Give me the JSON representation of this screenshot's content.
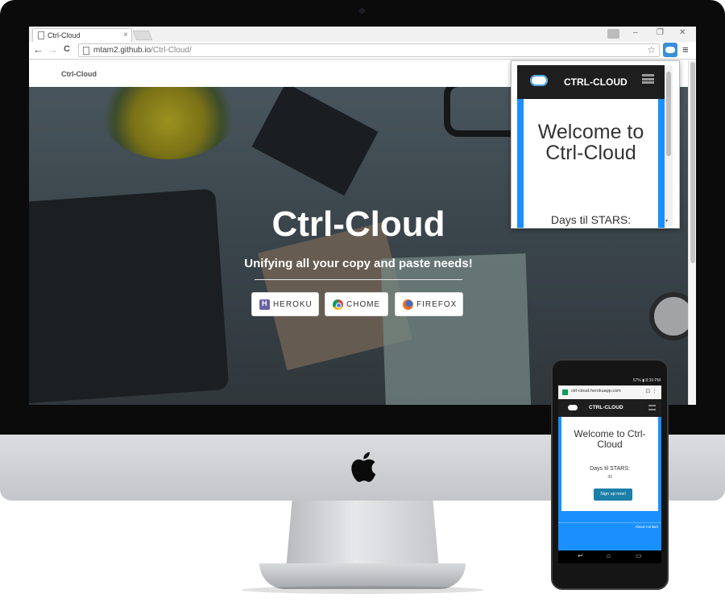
{
  "browser": {
    "tab_title": "Ctrl-Cloud",
    "tab_close": "×",
    "window_controls": {
      "minimize": "–",
      "restore": "❐",
      "close": "✕"
    },
    "nav": {
      "back": "←",
      "forward": "→",
      "reload": "C"
    },
    "url_host": "mtam2.github.io",
    "url_path": "/Ctrl-Cloud/",
    "star": "☆",
    "menu": "≡"
  },
  "site": {
    "brand": "Ctrl-Cloud",
    "hero_title": "Ctrl-Cloud",
    "hero_subtitle": "Unifying all your copy and paste needs!",
    "buttons": [
      {
        "label": "HEROKU",
        "icon": "heroku-icon"
      },
      {
        "label": "CHOME",
        "icon": "chrome-icon"
      },
      {
        "label": "FIREFOX",
        "icon": "firefox-icon"
      }
    ]
  },
  "popup": {
    "brand": "CTRL-CLOUD",
    "welcome": "Welcome to Ctrl-Cloud",
    "days_label": "Days til STARS:",
    "scroll_arrow": "▾"
  },
  "phone": {
    "status": "57% ▮ 8:39 PM",
    "url": "ctrl-cloud.herokuapp.com",
    "url_icons": "⊡ ⋮",
    "brand": "CTRL-CLOUD",
    "welcome": "Welcome to Ctrl-Cloud",
    "days_label": "Days til STARS:",
    "days_value": "30",
    "signup": "Sign up now!",
    "footer": "About   Contact",
    "nav": {
      "back": "↩",
      "home": "⌂",
      "recent": "▭"
    }
  },
  "colors": {
    "accent_blue": "#1a90ff",
    "header_dark": "#1e1e1e",
    "signup_button": "#1b7fa8"
  }
}
